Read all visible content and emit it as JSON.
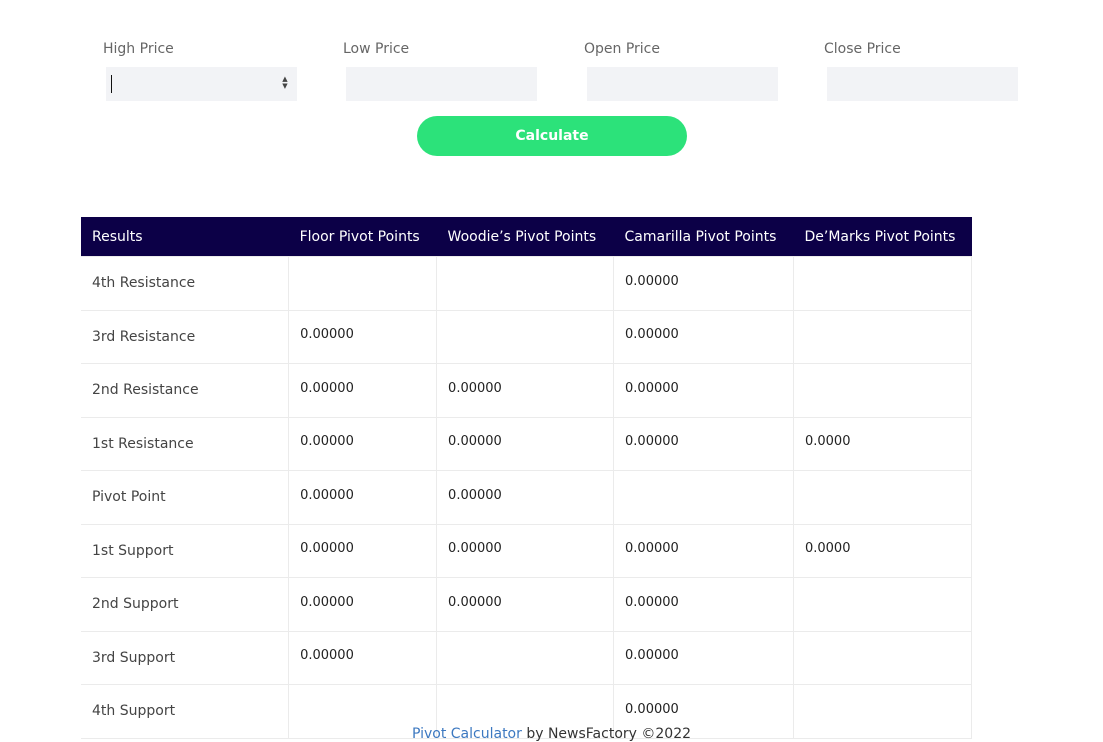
{
  "form": {
    "fields": [
      {
        "label": "High Price",
        "value": ""
      },
      {
        "label": "Low Price",
        "value": ""
      },
      {
        "label": "Open Price",
        "value": ""
      },
      {
        "label": "Close Price",
        "value": ""
      }
    ],
    "calculate_label": "Calculate"
  },
  "table": {
    "headers": [
      "Results",
      "Floor Pivot Points",
      "Woodie’s Pivot Points",
      "Camarilla Pivot Points",
      "De’Marks Pivot Points"
    ],
    "rows": [
      {
        "label": "4th Resistance",
        "floor": "",
        "woodie": "",
        "camarilla": "0.00000",
        "demark": ""
      },
      {
        "label": "3rd Resistance",
        "floor": "0.00000",
        "woodie": "",
        "camarilla": "0.00000",
        "demark": ""
      },
      {
        "label": "2nd Resistance",
        "floor": "0.00000",
        "woodie": "0.00000",
        "camarilla": "0.00000",
        "demark": ""
      },
      {
        "label": "1st Resistance",
        "floor": "0.00000",
        "woodie": "0.00000",
        "camarilla": "0.00000",
        "demark": "0.0000"
      },
      {
        "label": "Pivot Point",
        "floor": "0.00000",
        "woodie": "0.00000",
        "camarilla": "",
        "demark": ""
      },
      {
        "label": "1st Support",
        "floor": "0.00000",
        "woodie": "0.00000",
        "camarilla": "0.00000",
        "demark": "0.0000"
      },
      {
        "label": "2nd Support",
        "floor": "0.00000",
        "woodie": "0.00000",
        "camarilla": "0.00000",
        "demark": ""
      },
      {
        "label": "3rd Support",
        "floor": "0.00000",
        "woodie": "",
        "camarilla": "0.00000",
        "demark": ""
      },
      {
        "label": "4th Support",
        "floor": "",
        "woodie": "",
        "camarilla": "0.00000",
        "demark": ""
      }
    ]
  },
  "footer": {
    "link_text": "Pivot Calculator",
    "suffix": " by NewsFactory ©2022"
  },
  "colors": {
    "header_bg": "#0c0047",
    "button_bg": "#2ce27a",
    "link": "#3c78c0"
  }
}
